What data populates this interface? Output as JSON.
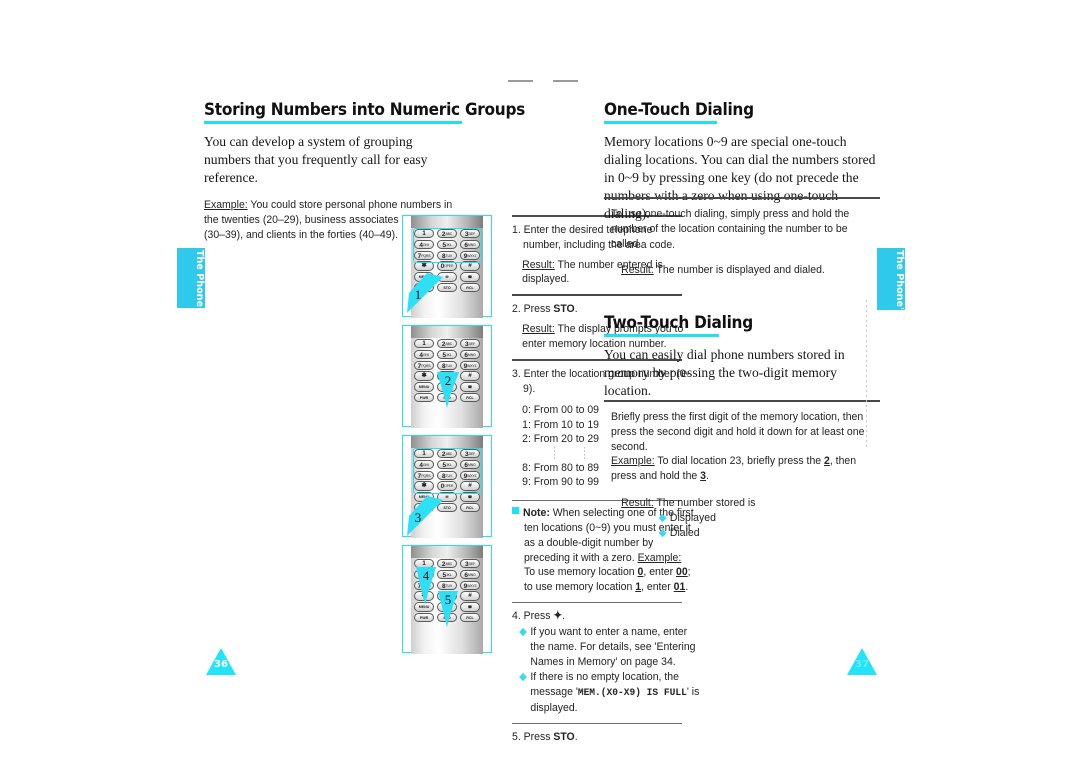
{
  "document": {
    "left_page_number": "36",
    "right_page_number": "37",
    "side_tab_text": "The Phone's Internal Phone Book",
    "accent_color": "#22e3f7"
  },
  "left_column": {
    "heading": "Storing Numbers into Numeric Groups",
    "intro": "You can develop a system of grouping numbers that you frequently call for easy reference.",
    "example_label": "Example:",
    "example_text": "You could store personal phone numbers in the twenties (20–29), business associates in the thirties (30–39), and clients in the forties (40–49).",
    "steps": [
      {
        "number": "1.",
        "text": "Enter the desired telephone number, including the area code.",
        "result_label": "Result:",
        "result_text": "The number entered is displayed."
      },
      {
        "number": "2.",
        "text_pre": "Press ",
        "key": "STO",
        "text_post": ".",
        "result_label": "Result:",
        "result_text": "The display prompts you to enter memory location number."
      },
      {
        "number": "3.",
        "text": "Enter the location group number (0-9).",
        "ranges_top": [
          "0: From 00 to 09",
          "1: From 10 to 19",
          "2: From 20 to 29"
        ],
        "ranges_bottom": [
          "8: From 80 to 89",
          "9: From 90 to 99"
        ]
      }
    ],
    "note": {
      "label": "Note:",
      "text": "When selecting one of the first ten locations (0~9) you must enter it as a double-digit number by preceding it with a zero.",
      "example_label": "Example:",
      "example_p1": "To use memory location ",
      "example_k1": "0",
      "example_p2": ", enter ",
      "example_k2": "00",
      "example_p3": "; to use memory location ",
      "example_k3": "1",
      "example_p4": ", enter ",
      "example_k4": "01",
      "example_p5": "."
    },
    "step4": {
      "number": "4.",
      "text_pre": "Press ",
      "key_glyph": "✦",
      "text_post": ".",
      "bullets": [
        "If you want to enter a name, enter the name. For details, see 'Entering Names in Memory' on page 34.",
        "If there is no empty location, the message 'MEM.(X0-X9) IS FULL' is displayed."
      ],
      "bullet2_pre": "If there is no empty location, the message '",
      "bullet2_mono": "MEM.(X0-X9) IS FULL",
      "bullet2_post": "' is displayed."
    },
    "step5": {
      "number": "5.",
      "text_pre": "Press ",
      "key": "STO",
      "text_post": "."
    },
    "phones": [
      {
        "callout": "1",
        "highlight": "keypad-digits",
        "pointer": "up-right"
      },
      {
        "callout": "2",
        "highlight": "none",
        "pointer": "down"
      },
      {
        "callout": "3",
        "highlight": "keypad-digits",
        "pointer": "up-right"
      },
      {
        "callout": "4",
        "highlight": "none",
        "pointer": "down"
      },
      {
        "callout": "5",
        "highlight": "none",
        "pointer": "down"
      }
    ],
    "keypad": {
      "rows": [
        [
          {
            "n": "1",
            "l": ""
          },
          {
            "n": "2",
            "l": "ABC"
          },
          {
            "n": "3",
            "l": "DEF"
          }
        ],
        [
          {
            "n": "4",
            "l": "GHI"
          },
          {
            "n": "5",
            "l": "JKL"
          },
          {
            "n": "6",
            "l": "MNO"
          }
        ],
        [
          {
            "n": "7",
            "l": "PQRS"
          },
          {
            "n": "8",
            "l": "TUV"
          },
          {
            "n": "9",
            "l": "WXYZ"
          }
        ],
        [
          {
            "n": "✱",
            "l": ""
          },
          {
            "n": "0",
            "l": "OPER"
          },
          {
            "n": "#",
            "l": ""
          }
        ],
        [
          {
            "s": "MENU"
          },
          {
            "s": "✉"
          },
          {
            "s": "☎"
          }
        ],
        [
          {
            "s": "PWR"
          },
          {
            "s": "STO"
          },
          {
            "s": "RCL"
          }
        ]
      ]
    }
  },
  "right_column": {
    "section1": {
      "heading": "One-Touch Dialing",
      "intro": "Memory locations 0~9 are special one-touch dialing locations. You can dial the numbers stored in 0~9 by pressing one key (do not precede the numbers with a zero when using one-touch dialing).",
      "detail": "To use one-touch dialing, simply press and hold the number of the location containing the number to be called.",
      "result_label": "Result:",
      "result_text": "The number is displayed and dialed."
    },
    "section2": {
      "heading": "Two-Touch Dialing",
      "intro": "You can easily dial phone numbers stored in memory by pressing the two-digit memory location.",
      "detail": "Briefly press the first digit of the memory location, then press the second digit and hold it down for at least one second.",
      "example_label": "Example:",
      "example_p1": "To dial location 23, briefly press the ",
      "example_k1": "2",
      "example_p2": ", then press and hold the ",
      "example_k2": "3",
      "example_p3": ".",
      "result_label": "Result:",
      "result_text": "The number stored is",
      "bullets": [
        "Displayed",
        "Dialed"
      ]
    }
  }
}
